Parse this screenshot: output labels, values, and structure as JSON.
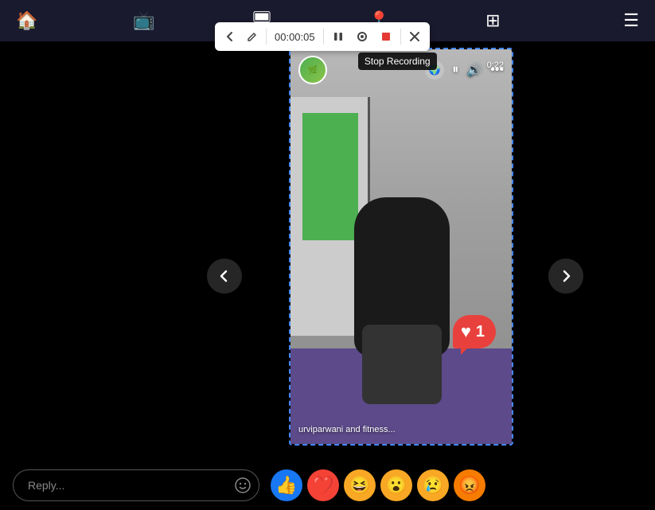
{
  "topBar": {
    "homeIcon": "🏠",
    "tvIcon": "📺",
    "screenIcon": "🖥",
    "locationIcon": "📍",
    "windowIcon": "⊞",
    "menuIcon": "☰"
  },
  "recordingToolbar": {
    "backLabel": "‹",
    "pencilLabel": "✏",
    "timer": "00:00:05",
    "pauseLabel": "⏸",
    "circleLabel": "⊙",
    "stopLabel": "⏹",
    "closeLabel": "✕",
    "stopTooltip": "Stop Recording"
  },
  "videoCard": {
    "duration": "0:22",
    "caption": "urviparwani and fitness...",
    "loveCount": "1"
  },
  "navArrows": {
    "leftLabel": "‹",
    "rightLabel": "›"
  },
  "bottomBar": {
    "replyPlaceholder": "Reply...",
    "reactions": [
      {
        "id": "like",
        "emoji": "👍",
        "class": "reaction-like"
      },
      {
        "id": "love",
        "emoji": "❤️",
        "class": "reaction-love"
      },
      {
        "id": "haha",
        "emoji": "😆",
        "class": "reaction-haha"
      },
      {
        "id": "wow",
        "emoji": "😮",
        "class": "reaction-wow"
      },
      {
        "id": "sad",
        "emoji": "😢",
        "class": "reaction-sad"
      },
      {
        "id": "angry",
        "emoji": "😡",
        "class": "reaction-angry"
      }
    ]
  }
}
